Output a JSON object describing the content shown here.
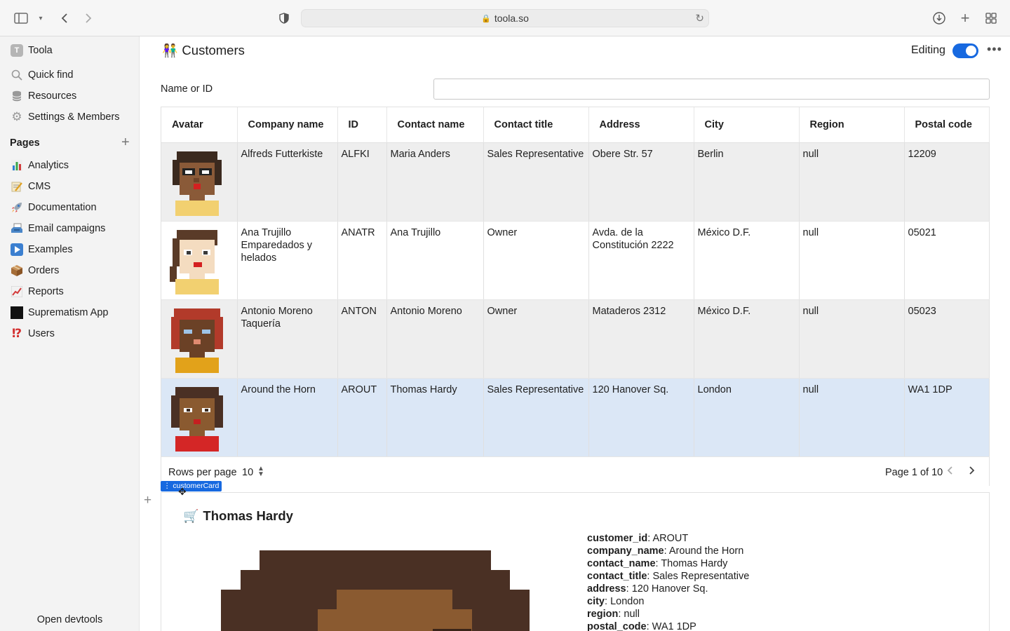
{
  "browser": {
    "url": "toola.so"
  },
  "sidebar": {
    "app_name": "Toola",
    "top_items": [
      {
        "label": "Quick find",
        "icon": "search-icon"
      },
      {
        "label": "Resources",
        "icon": "database-icon"
      },
      {
        "label": "Settings & Members",
        "icon": "gear-icon"
      }
    ],
    "pages_heading": "Pages",
    "pages": [
      {
        "label": "Analytics",
        "icon": "📊"
      },
      {
        "label": "CMS",
        "icon": "📝"
      },
      {
        "label": "Documentation",
        "icon": "🚀"
      },
      {
        "label": "Email campaigns",
        "icon": "📨"
      },
      {
        "label": "Examples",
        "icon": "▶️"
      },
      {
        "label": "Orders",
        "icon": "📦"
      },
      {
        "label": "Reports",
        "icon": "📈"
      },
      {
        "label": "Suprematism App",
        "icon": "⬛"
      },
      {
        "label": "Users",
        "icon": "⁉️"
      }
    ],
    "devtools": "Open devtools"
  },
  "header": {
    "emoji": "👫",
    "title": "Customers",
    "editing_label": "Editing",
    "editing_on": true
  },
  "filter": {
    "label": "Name or ID",
    "value": "",
    "placeholder": ""
  },
  "table": {
    "columns": [
      "Avatar",
      "Company name",
      "ID",
      "Contact name",
      "Contact title",
      "Address",
      "City",
      "Region",
      "Postal code"
    ],
    "rows": [
      {
        "company": "Alfreds Futterkiste",
        "id": "ALFKI",
        "contact": "Maria Anders",
        "title": "Sales Representative",
        "address": "Obere Str. 57",
        "city": "Berlin",
        "region": "null",
        "postal": "12209",
        "avatar": "glasses-woman"
      },
      {
        "company": "Ana Trujillo Emparedados y helados",
        "id": "ANATR",
        "contact": "Ana Trujillo",
        "title": "Owner",
        "address": "Avda. de la Constitución 2222",
        "city": "México D.F.",
        "region": "null",
        "postal": "05021",
        "avatar": "light-woman"
      },
      {
        "company": "Antonio Moreno Taquería",
        "id": "ANTON",
        "contact": "Antonio Moreno",
        "title": "Owner",
        "address": "Mataderos 2312",
        "city": "México D.F.",
        "region": "null",
        "postal": "05023",
        "avatar": "red-hair-man"
      },
      {
        "company": "Around the Horn",
        "id": "AROUT",
        "contact": "Thomas Hardy",
        "title": "Sales Representative",
        "address": "120 Hanover Sq.",
        "city": "London",
        "region": "null",
        "postal": "WA1 1DP",
        "avatar": "curly-woman"
      }
    ],
    "rows_per_page_label": "Rows per page",
    "rows_per_page": "10",
    "page_info": "Page 1 of 10"
  },
  "component_tag": "customerCard",
  "card": {
    "emoji": "🛒",
    "title": "Thomas Hardy",
    "fields": [
      {
        "key": "customer_id",
        "value": "AROUT"
      },
      {
        "key": "company_name",
        "value": "Around the Horn"
      },
      {
        "key": "contact_name",
        "value": "Thomas Hardy"
      },
      {
        "key": "contact_title",
        "value": "Sales Representative"
      },
      {
        "key": "address",
        "value": "120 Hanover Sq."
      },
      {
        "key": "city",
        "value": "London"
      },
      {
        "key": "region",
        "value": "null"
      },
      {
        "key": "postal_code",
        "value": "WA1 1DP"
      }
    ]
  },
  "colors": {
    "accent": "#1769e0",
    "selected_row": "#dbe7f6",
    "striped_row": "#eeeeee"
  }
}
